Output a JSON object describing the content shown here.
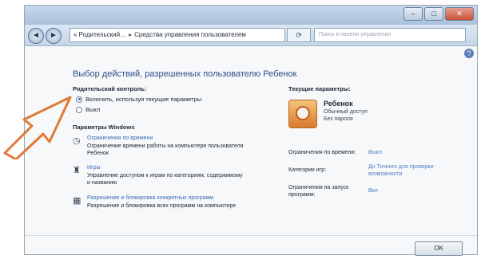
{
  "window": {
    "buttons": {
      "minimize": "‒",
      "maximize": "□",
      "close": "✕"
    }
  },
  "nav": {
    "back": "◄",
    "forward": "►",
    "breadcrumb": [
      "« Родительский…",
      "Средства управления пользователем"
    ],
    "refresh": "⟳",
    "search_placeholder": "Поиск в панели управления"
  },
  "help": "?",
  "main": {
    "heading": "Выбор действий, разрешенных пользователю Ребенок",
    "parental_control": {
      "title": "Родительский контроль:",
      "options": [
        {
          "label": "Включить, используя текущие параметры",
          "selected": true
        },
        {
          "label": "Выкл",
          "selected": false
        }
      ]
    },
    "windows_settings": {
      "title": "Параметры Windows",
      "items": [
        {
          "icon": "clock-icon",
          "glyph": "◷",
          "link": "Ограничения по времени",
          "desc": "Ограничение времени работы на компьютере пользователя Ребенок"
        },
        {
          "icon": "games-icon",
          "glyph": "♜",
          "link": "Игры",
          "desc": "Управление доступом к играм по категориям, содержимому и названию"
        },
        {
          "icon": "programs-icon",
          "glyph": "▦",
          "link": "Разрешение и блокировка конкретных программ",
          "desc": "Разрешение и блокировка всех программ на компьютере"
        }
      ]
    }
  },
  "current": {
    "title": "Текущие параметры:",
    "user": {
      "name": "Ребенок",
      "role": "Обычный доступ",
      "password": "Без пароля"
    },
    "params": [
      {
        "label": "Ограничения по времени:",
        "value": "Выкл"
      },
      {
        "label": "Категории игр:",
        "value": "До Точного для проверки возможности"
      },
      {
        "label": "Ограничения на запуск программ:",
        "value": "Вкл"
      }
    ]
  },
  "ok_label": "OK",
  "colors": {
    "arrow": "#e0783a",
    "link": "#3a6db5",
    "heading": "#2a4e86"
  }
}
